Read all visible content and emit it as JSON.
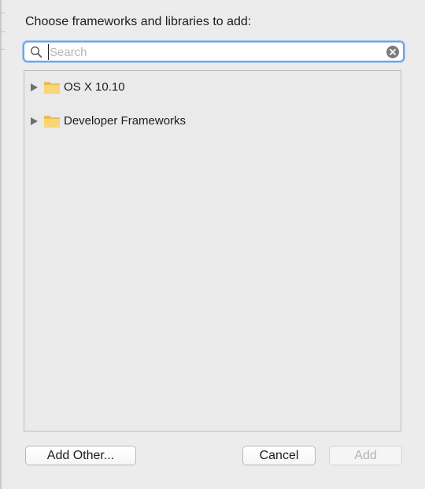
{
  "dialog": {
    "prompt": "Choose frameworks and libraries to add:"
  },
  "search": {
    "placeholder": "Search",
    "value": ""
  },
  "tree": {
    "items": [
      {
        "label": "OS X 10.10",
        "icon": "folder-icon",
        "expanded": false
      },
      {
        "label": "Developer Frameworks",
        "icon": "folder-icon",
        "expanded": false
      }
    ]
  },
  "buttons": {
    "add_other": "Add Other...",
    "cancel": "Cancel",
    "add": "Add"
  },
  "colors": {
    "focus_ring": "#6ea5e9",
    "folder": "#f3cf6b",
    "disabled_text": "#b3b3b3"
  }
}
